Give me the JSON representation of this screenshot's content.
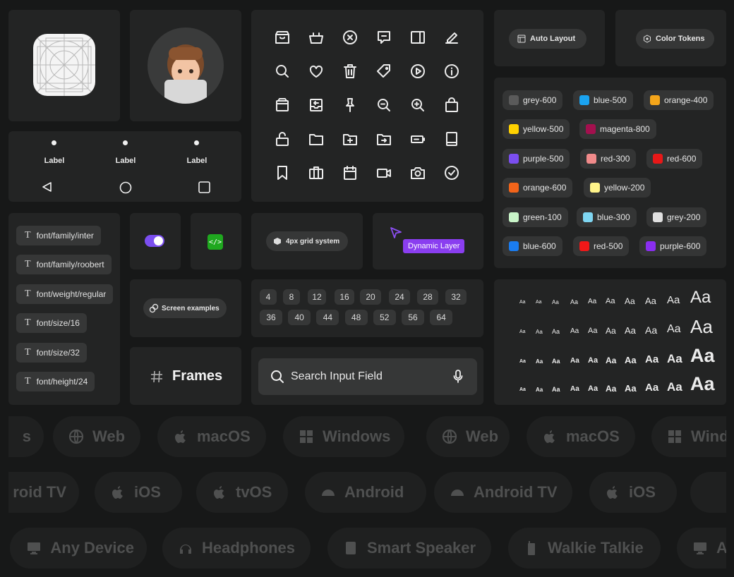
{
  "nav": {
    "label1": "Label",
    "label2": "Label",
    "label3": "Label"
  },
  "buttons": {
    "auto_layout": "Auto Layout",
    "color_tokens": "Color Tokens",
    "grid_system": "4px grid system",
    "screen_examples": "Screen examples",
    "dynamic_layer": "Dynamic Layer",
    "frames": "Frames"
  },
  "search": {
    "placeholder": "Search Input Field"
  },
  "font_tokens": [
    "font/family/inter",
    "font/family/roobert",
    "font/weight/regular",
    "font/size/16",
    "font/size/32",
    "font/height/24"
  ],
  "swatches": [
    {
      "name": "grey-600",
      "color": "#5a5a5a"
    },
    {
      "name": "blue-500",
      "color": "#1aa3f0"
    },
    {
      "name": "orange-400",
      "color": "#f4a51a"
    },
    {
      "name": "yellow-500",
      "color": "#ffd200"
    },
    {
      "name": "magenta-800",
      "color": "#a3104e"
    },
    {
      "name": "purple-500",
      "color": "#7b4ef0"
    },
    {
      "name": "red-300",
      "color": "#f08a8a"
    },
    {
      "name": "red-600",
      "color": "#e81818"
    },
    {
      "name": "orange-600",
      "color": "#f2641a"
    },
    {
      "name": "yellow-200",
      "color": "#fff48a"
    },
    {
      "name": "green-100",
      "color": "#c9f5c9"
    },
    {
      "name": "blue-300",
      "color": "#7fd6f2"
    },
    {
      "name": "grey-200",
      "color": "#e0e0e0"
    },
    {
      "name": "blue-600",
      "color": "#1a7cf0"
    },
    {
      "name": "red-500",
      "color": "#f01818"
    },
    {
      "name": "purple-600",
      "color": "#8a2ef0"
    }
  ],
  "spacing_row1": [
    "4",
    "8",
    "12",
    "16",
    "20",
    "24",
    "28",
    "32"
  ],
  "spacing_row2": [
    "36",
    "40",
    "44",
    "48",
    "52",
    "56",
    "64"
  ],
  "type_scale_label": "Aa",
  "platforms_row1": [
    "s",
    "Web",
    "macOS",
    "Windows",
    "Web",
    "macOS",
    "Wind"
  ],
  "platforms_row2": [
    "roid TV",
    "iOS",
    "tvOS",
    "Android",
    "Android TV",
    "iOS",
    ""
  ],
  "platforms_row3": [
    "Any Device",
    "Headphones",
    "Smart Speaker",
    "Walkie Talkie",
    "A"
  ],
  "icons": [
    "archive-box-icon",
    "basket-icon",
    "x-circle-icon",
    "message-square-icon",
    "sidebar-right-icon",
    "pencil-icon",
    "search-icon",
    "heart-icon",
    "trash-icon",
    "tag-icon",
    "play-circle-icon",
    "info-circle-icon",
    "package-icon",
    "inbox-return-icon",
    "pin-icon",
    "zoom-out-icon",
    "zoom-in-icon",
    "shopping-bag-icon",
    "unlock-icon",
    "folder-icon",
    "folder-plus-icon",
    "folder-arrow-icon",
    "battery-icon",
    "book-icon",
    "bookmark-icon",
    "briefcase-icon",
    "calendar-icon",
    "video-icon",
    "camera-icon",
    "check-circle-icon"
  ],
  "colors": {
    "toggle": "#7b4ef0",
    "code_badge": "#1fa81f",
    "dynamic_layer": "#8a3ef0",
    "cursor": "#8a4ef0"
  }
}
